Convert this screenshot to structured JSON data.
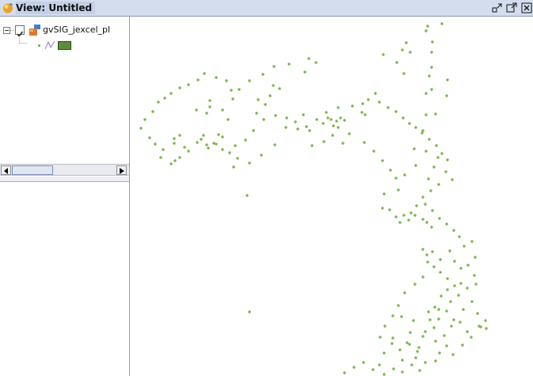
{
  "window": {
    "title": "View: Untitled",
    "title_icon": "gvsig-view-icon",
    "buttons": [
      "restore-icon",
      "maximize-icon",
      "close-icon"
    ]
  },
  "toc": {
    "layers": [
      {
        "name": "gvSIG_jexcel_pl",
        "checked": true,
        "expanded": true,
        "icon": "layer-icon",
        "legend_symbols": [
          "point-symbol",
          "line-symbol",
          "polygon-symbol"
        ],
        "legend_color": "#6aa84f",
        "polygon_fill": "#5e8b3a"
      }
    ]
  },
  "colors": {
    "point_color": "#7ab648",
    "title_bar": "#c4d0e8",
    "panel_border": "#9aa0aa"
  }
}
